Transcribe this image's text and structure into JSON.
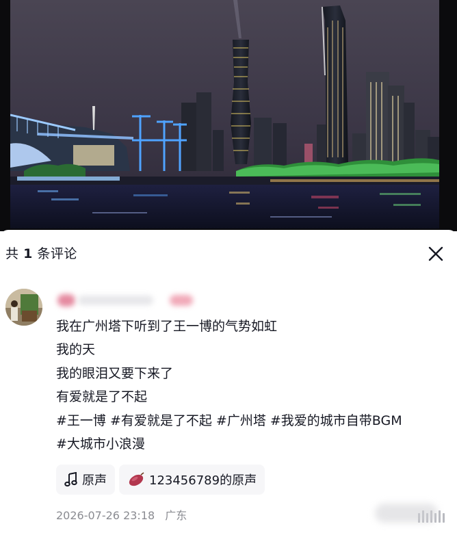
{
  "video": {
    "scene": "night-skyline-riverfront",
    "colors": {
      "sky": "#3a3545",
      "water": "#15172b",
      "bridge_glow": "#6fb3ff",
      "tree_glow": "#38c24b"
    }
  },
  "comments_panel": {
    "title_prefix": "共",
    "count": "1",
    "title_suffix": "条评论",
    "close_icon": "close-icon"
  },
  "comment": {
    "avatar_icon": "avatar",
    "lines": [
      "我在广州塔下听到了王一博的气势如虹",
      "我的天",
      "我的眼泪又要下来了",
      "有爱就是了不起",
      "#王一博 #有爱就是了不起 #广州塔 #我爱的城市自带BGM",
      "#大城市小浪漫"
    ],
    "music": [
      {
        "icon": "music-note-icon",
        "label": "原声"
      },
      {
        "icon": "sweet-potato-icon",
        "label": "123456789的原声"
      }
    ],
    "timestamp": "2026-07-26 23:18",
    "location": "广东"
  }
}
